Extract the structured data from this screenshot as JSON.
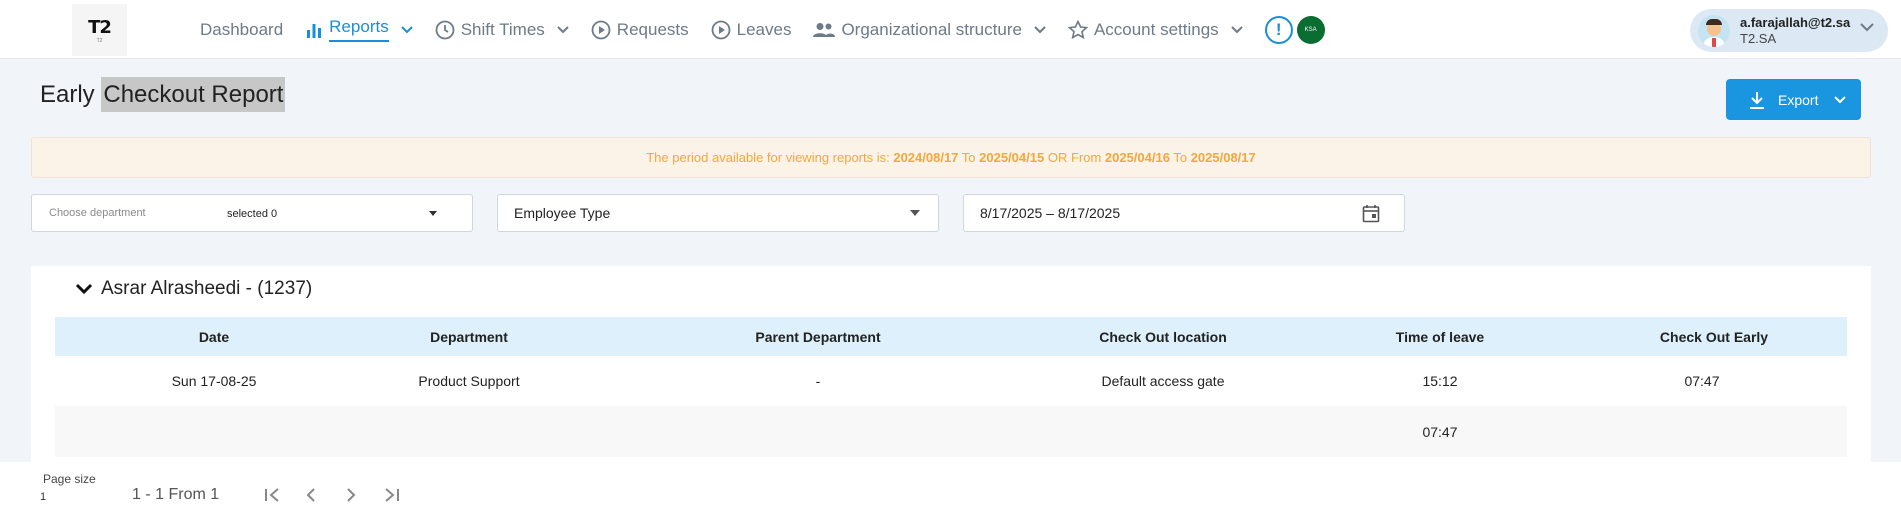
{
  "brand": {
    "logo_text": "T2",
    "logo_sub": "T2"
  },
  "nav": {
    "items": [
      {
        "label": "Dashboard"
      },
      {
        "label": "Reports"
      },
      {
        "label": "Shift Times"
      },
      {
        "label": "Requests"
      },
      {
        "label": "Leaves"
      },
      {
        "label": "Organizational structure"
      },
      {
        "label": "Account settings"
      }
    ],
    "alert_glyph": "!",
    "flag_text": "KSA"
  },
  "user": {
    "email": "a.farajallah@t2.sa",
    "org": "T2.SA"
  },
  "page": {
    "title_part1": "Early ",
    "title_part2": "Checkout Report"
  },
  "export": {
    "label": "Export"
  },
  "notice": {
    "prefix": "The period available for viewing reports is: ",
    "d1": "2024/08/17",
    "to1": " To ",
    "d2": "2025/04/15",
    "or": " OR From ",
    "d3": "2025/04/16",
    "to2": " To ",
    "d4": "2025/08/17"
  },
  "filters": {
    "department_placeholder": "Choose department",
    "department_value": "selected 0",
    "employee_type": "Employee Type",
    "date_range": "8/17/2025 – 8/17/2025"
  },
  "group": {
    "title": "Asrar Alrasheedi - (1237)"
  },
  "table": {
    "headers": [
      "Date",
      "Department",
      "Parent Department",
      "Check Out location",
      "Time of leave",
      "Check Out Early"
    ],
    "rows": [
      [
        "Sun 17-08-25",
        "Product Support",
        "-",
        "Default access gate",
        "15:12",
        "07:47"
      ]
    ],
    "total_label": "07:47"
  },
  "pager": {
    "page_size_label": "Page size",
    "page_size_value": "1",
    "range": "1 - 1 From 1"
  },
  "colors": {
    "accent": "#1a8fd8",
    "notice_text": "#f3a83b",
    "table_header_bg": "#ddf0fb"
  }
}
